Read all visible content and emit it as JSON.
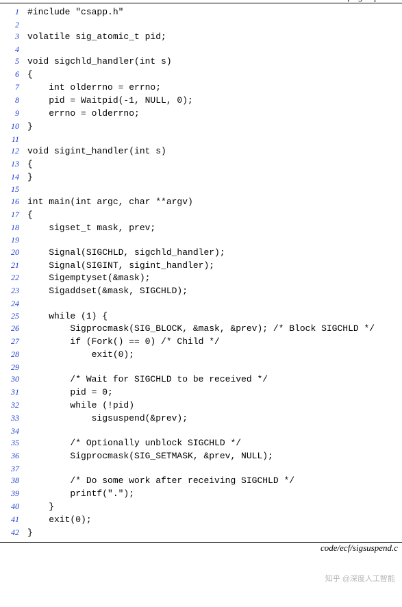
{
  "filepath": "code/ecf/sigsuspend.c",
  "watermark": "知乎 @深度人工智能",
  "lines": [
    {
      "n": 1,
      "t": "#include \"csapp.h\""
    },
    {
      "n": 2,
      "t": ""
    },
    {
      "n": 3,
      "t": "volatile sig_atomic_t pid;"
    },
    {
      "n": 4,
      "t": ""
    },
    {
      "n": 5,
      "t": "void sigchld_handler(int s)"
    },
    {
      "n": 6,
      "t": "{"
    },
    {
      "n": 7,
      "t": "    int olderrno = errno;"
    },
    {
      "n": 8,
      "t": "    pid = Waitpid(-1, NULL, 0);"
    },
    {
      "n": 9,
      "t": "    errno = olderrno;"
    },
    {
      "n": 10,
      "t": "}"
    },
    {
      "n": 11,
      "t": ""
    },
    {
      "n": 12,
      "t": "void sigint_handler(int s)"
    },
    {
      "n": 13,
      "t": "{"
    },
    {
      "n": 14,
      "t": "}"
    },
    {
      "n": 15,
      "t": ""
    },
    {
      "n": 16,
      "t": "int main(int argc, char **argv)"
    },
    {
      "n": 17,
      "t": "{"
    },
    {
      "n": 18,
      "t": "    sigset_t mask, prev;"
    },
    {
      "n": 19,
      "t": ""
    },
    {
      "n": 20,
      "t": "    Signal(SIGCHLD, sigchld_handler);"
    },
    {
      "n": 21,
      "t": "    Signal(SIGINT, sigint_handler);"
    },
    {
      "n": 22,
      "t": "    Sigemptyset(&mask);"
    },
    {
      "n": 23,
      "t": "    Sigaddset(&mask, SIGCHLD);"
    },
    {
      "n": 24,
      "t": ""
    },
    {
      "n": 25,
      "t": "    while (1) {"
    },
    {
      "n": 26,
      "t": "        Sigprocmask(SIG_BLOCK, &mask, &prev); /* Block SIGCHLD */"
    },
    {
      "n": 27,
      "t": "        if (Fork() == 0) /* Child */"
    },
    {
      "n": 28,
      "t": "            exit(0);"
    },
    {
      "n": 29,
      "t": ""
    },
    {
      "n": 30,
      "t": "        /* Wait for SIGCHLD to be received */"
    },
    {
      "n": 31,
      "t": "        pid = 0;"
    },
    {
      "n": 32,
      "t": "        while (!pid)"
    },
    {
      "n": 33,
      "t": "            sigsuspend(&prev);"
    },
    {
      "n": 34,
      "t": ""
    },
    {
      "n": 35,
      "t": "        /* Optionally unblock SIGCHLD */"
    },
    {
      "n": 36,
      "t": "        Sigprocmask(SIG_SETMASK, &prev, NULL);"
    },
    {
      "n": 37,
      "t": ""
    },
    {
      "n": 38,
      "t": "        /* Do some work after receiving SIGCHLD */"
    },
    {
      "n": 39,
      "t": "        printf(\".\");"
    },
    {
      "n": 40,
      "t": "    }"
    },
    {
      "n": 41,
      "t": "    exit(0);"
    },
    {
      "n": 42,
      "t": "}"
    }
  ]
}
